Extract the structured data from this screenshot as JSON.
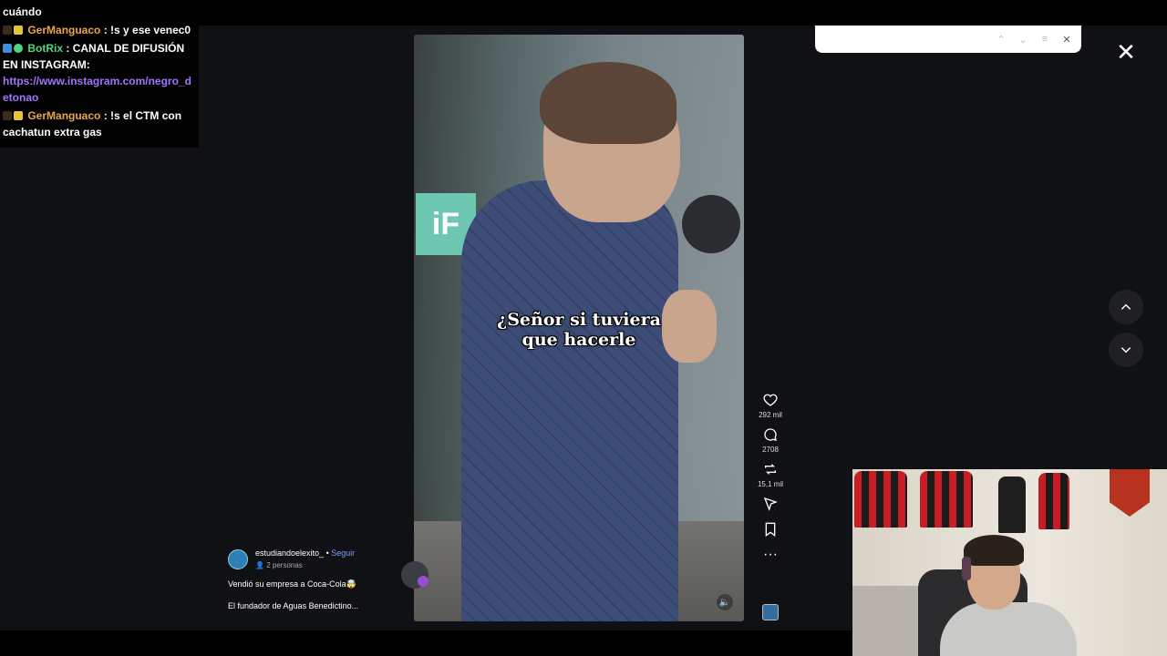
{
  "chat": {
    "top_fragment": "cuándo",
    "messages": [
      {
        "user": "GerManguaco",
        "text": ": !s y ese venec0"
      },
      {
        "user": "BotRix",
        "text": ": CANAL DE DIFUSIÓN EN INSTAGRAM:",
        "link": "https://www.instagram.com/negro_detonao"
      },
      {
        "user": "GerManguaco",
        "text": ": !s el CTM con cachatun extra gas"
      }
    ]
  },
  "video": {
    "caption_line1": "¿Señor si tuviera",
    "caption_line2": "que hacerle",
    "sign_text": "iF"
  },
  "actions": {
    "likes": "292 mil",
    "comments": "2708",
    "reposts": "15,1 mil"
  },
  "post": {
    "author": "estudiandoelexito_",
    "separator": " • ",
    "follow_label": "Seguir",
    "people": "2 personas",
    "description": "Vendió su empresa a Coca-Cola🤯",
    "description2": "El fundador de Aguas Benedictino..."
  },
  "search": {
    "value": "",
    "placeholder": ""
  },
  "icons": {
    "like": "heart-icon",
    "comment": "comment-icon",
    "repost": "repost-icon",
    "send": "send-icon",
    "save": "bookmark-icon",
    "more": "more-icon",
    "close": "close-icon"
  },
  "colors": {
    "username_ger": "#e9a64a",
    "username_bot": "#4fd77c",
    "link": "#a074ff",
    "follow": "#7e9bff"
  }
}
